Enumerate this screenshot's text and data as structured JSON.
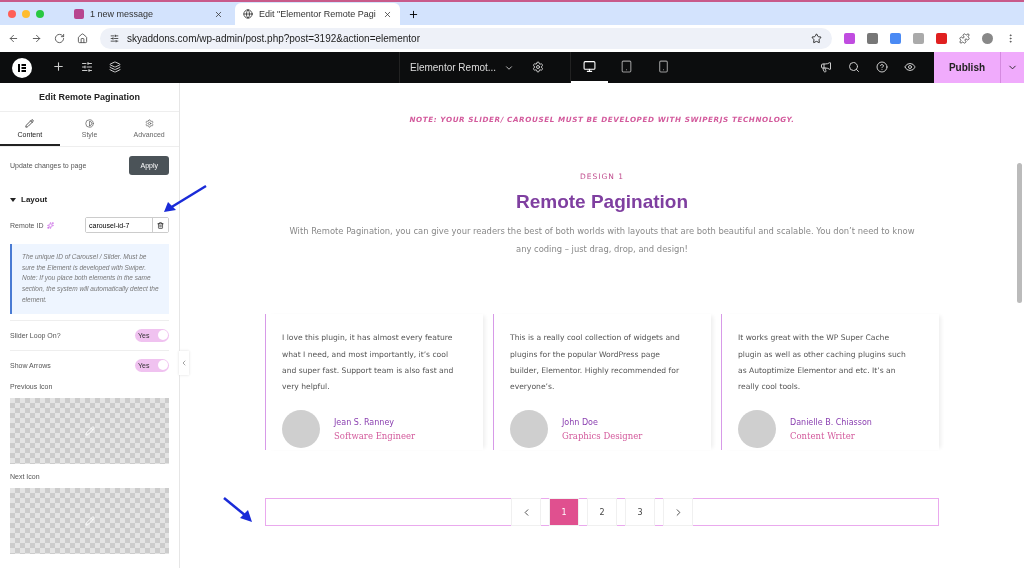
{
  "browser": {
    "tabs": [
      {
        "title": "1 new message",
        "selected": false
      },
      {
        "title": "Edit \"Elementor Remote Pagi",
        "selected": true
      }
    ],
    "url": "skyaddons.com/wp-admin/post.php?post=3192&action=elementor"
  },
  "editor_bar": {
    "document": "Elementor Remot...",
    "devices": [
      {
        "kind": "desktop",
        "selected": true
      },
      {
        "kind": "tablet",
        "selected": false
      },
      {
        "kind": "mobile",
        "selected": false
      }
    ],
    "publish": "Publish"
  },
  "panel": {
    "title": "Edit Remote Pagination",
    "tabs": [
      {
        "kind": "content",
        "label": "Content",
        "selected": true
      },
      {
        "kind": "style",
        "label": "Style",
        "selected": false
      },
      {
        "kind": "advanced",
        "label": "Advanced",
        "selected": false
      }
    ],
    "update_label": "Update changes to page",
    "apply": "Apply",
    "section": "Layout",
    "remote_id_label": "Remote ID",
    "remote_id_value": "carousel-id-7",
    "info": "The unique ID of Carousel / Slider. Must be sure the Element is developed with Swiper. Note: If you place both elements in the same section, the system will automatically detect the element.",
    "toggles": [
      {
        "label": "Slider Loop On?",
        "on": true,
        "text": "Yes"
      },
      {
        "label": "Show Arrows",
        "on": true,
        "text": "Yes"
      }
    ],
    "icon_pickers": [
      {
        "label": "Previous Icon"
      },
      {
        "label": "Next Icon"
      }
    ]
  },
  "canvas": {
    "note": "NOTE: YOUR SLIDER/ CAROUSEL MUST BE DEVELOPED WITH SWIPERJS TECHNOLOGY.",
    "eyebrow": "DESIGN 1",
    "title": "Remote Pagination",
    "intro": "With Remote Pagination, you can give your readers the best of both worlds with layouts that are both beautiful and scalable. You don’t need to know any coding – just drag, drop, and design!",
    "testimonials": [
      {
        "text": "I love this plugin, it has almost every feature what I need, and most importantly, it’s cool and super fast. Support team is also fast and very helpful.",
        "name": "Jean S. Ranney",
        "role": "Software Engineer"
      },
      {
        "text": "This is a really cool collection of widgets and plugins for the popular WordPress page builder, Elementor. Highly recommended for everyone’s.",
        "name": "John Doe",
        "role": "Graphics Designer"
      },
      {
        "text": "It works great with the WP Super Cache plugin as well as other caching plugins such as Autoptimize Elementor and etc. It’s an really cool tools.",
        "name": "Danielle B. Chiasson",
        "role": "Content Writer"
      }
    ],
    "pages": [
      {
        "label": "1",
        "selected": true
      },
      {
        "label": "2",
        "selected": false
      },
      {
        "label": "3",
        "selected": false
      }
    ]
  }
}
